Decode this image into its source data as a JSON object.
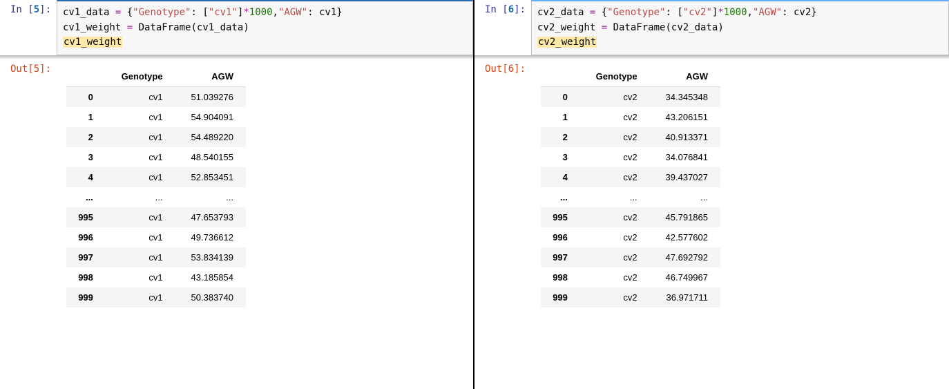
{
  "left": {
    "in_prompt_prefix": "In [",
    "in_prompt_num": "5",
    "in_prompt_suffix": "]:",
    "out_prompt_prefix": "Out[",
    "out_prompt_num": "5",
    "out_prompt_suffix": "]:",
    "code": {
      "line1": {
        "v1": "cv1_data",
        "op1": " = ",
        "b1": "{",
        "s1": "\"Genotype\"",
        "c1": ": ",
        "b2": "[",
        "s2": "\"cv1\"",
        "b3": "]",
        "op2": "*",
        "n1": "1000",
        "c2": ",",
        "s3": "\"AGW\"",
        "c3": ": ",
        "v2": "cv1",
        "b4": "}"
      },
      "line2": {
        "v1": "cv1_weight",
        "op1": " = ",
        "fn": "DataFrame",
        "p1": "(",
        "arg": "cv1_data",
        "p2": ")"
      },
      "line3": "cv1_weight"
    },
    "columns": [
      "Genotype",
      "AGW"
    ],
    "rows": [
      {
        "idx": "0",
        "geno": "cv1",
        "agw": "51.039276"
      },
      {
        "idx": "1",
        "geno": "cv1",
        "agw": "54.904091"
      },
      {
        "idx": "2",
        "geno": "cv1",
        "agw": "54.489220"
      },
      {
        "idx": "3",
        "geno": "cv1",
        "agw": "48.540155"
      },
      {
        "idx": "4",
        "geno": "cv1",
        "agw": "52.853451"
      },
      {
        "idx": "...",
        "geno": "...",
        "agw": "...",
        "ell": true
      },
      {
        "idx": "995",
        "geno": "cv1",
        "agw": "47.653793"
      },
      {
        "idx": "996",
        "geno": "cv1",
        "agw": "49.736612"
      },
      {
        "idx": "997",
        "geno": "cv1",
        "agw": "53.834139"
      },
      {
        "idx": "998",
        "geno": "cv1",
        "agw": "43.185854"
      },
      {
        "idx": "999",
        "geno": "cv1",
        "agw": "50.383740"
      }
    ]
  },
  "right": {
    "in_prompt_prefix": "In [",
    "in_prompt_num": "6",
    "in_prompt_suffix": "]:",
    "out_prompt_prefix": "Out[",
    "out_prompt_num": "6",
    "out_prompt_suffix": "]:",
    "code": {
      "line1": {
        "v1": "cv2_data",
        "op1": " = ",
        "b1": "{",
        "s1": "\"Genotype\"",
        "c1": ": ",
        "b2": "[",
        "s2": "\"cv2\"",
        "b3": "]",
        "op2": "*",
        "n1": "1000",
        "c2": ",",
        "s3": "\"AGW\"",
        "c3": ": ",
        "v2": "cv2",
        "b4": "}"
      },
      "line2": {
        "v1": "cv2_weight",
        "op1": " = ",
        "fn": "DataFrame",
        "p1": "(",
        "arg": "cv2_data",
        "p2": ")"
      },
      "line3": "cv2_weight"
    },
    "columns": [
      "Genotype",
      "AGW"
    ],
    "rows": [
      {
        "idx": "0",
        "geno": "cv2",
        "agw": "34.345348"
      },
      {
        "idx": "1",
        "geno": "cv2",
        "agw": "43.206151"
      },
      {
        "idx": "2",
        "geno": "cv2",
        "agw": "40.913371"
      },
      {
        "idx": "3",
        "geno": "cv2",
        "agw": "34.076841"
      },
      {
        "idx": "4",
        "geno": "cv2",
        "agw": "39.437027"
      },
      {
        "idx": "...",
        "geno": "...",
        "agw": "...",
        "ell": true
      },
      {
        "idx": "995",
        "geno": "cv2",
        "agw": "45.791865"
      },
      {
        "idx": "996",
        "geno": "cv2",
        "agw": "42.577602"
      },
      {
        "idx": "997",
        "geno": "cv2",
        "agw": "47.692792"
      },
      {
        "idx": "998",
        "geno": "cv2",
        "agw": "46.749967"
      },
      {
        "idx": "999",
        "geno": "cv2",
        "agw": "36.971711"
      }
    ]
  }
}
